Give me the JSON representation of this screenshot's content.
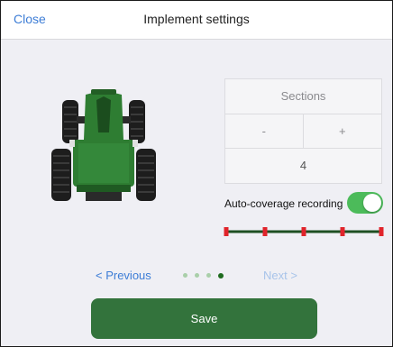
{
  "navbar": {
    "close_label": "Close",
    "title": "Implement settings"
  },
  "tractor": {
    "icon": "tractor-illustration",
    "body_color": "#2c7a2f"
  },
  "sections": {
    "title": "Sections",
    "minus_label": "-",
    "plus_label": "+",
    "value": "4"
  },
  "auto_coverage": {
    "label": "Auto-coverage recording",
    "enabled": true,
    "toggle_color": "#4cbb5a"
  },
  "section_bar": {
    "count": 4,
    "line_color": "#1e4f22",
    "marker_color": "#e0242b"
  },
  "pager": {
    "previous_label": "< Previous",
    "next_label": "Next >",
    "page_count": 4,
    "current_page": 4
  },
  "save": {
    "label": "Save",
    "color": "#33733c"
  }
}
